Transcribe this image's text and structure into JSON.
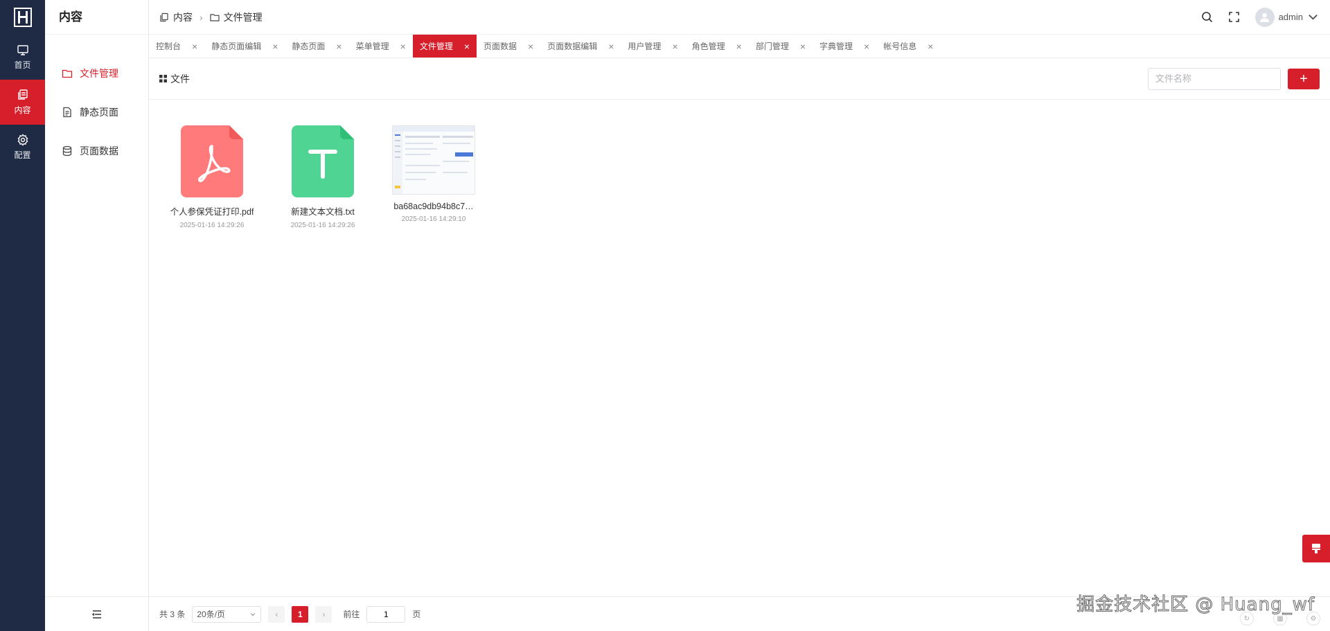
{
  "rail": {
    "items": [
      {
        "label": "首页",
        "icon": "monitor-icon"
      },
      {
        "label": "内容",
        "icon": "copy-icon"
      },
      {
        "label": "配置",
        "icon": "gear-icon"
      }
    ]
  },
  "submenu": {
    "title": "内容",
    "items": [
      {
        "label": "文件管理",
        "icon": "folder-icon"
      },
      {
        "label": "静态页面",
        "icon": "document-icon"
      },
      {
        "label": "页面数据",
        "icon": "database-icon"
      }
    ]
  },
  "breadcrumb": {
    "section": "内容",
    "page": "文件管理"
  },
  "user": {
    "name": "admin"
  },
  "tabs": [
    {
      "label": "控制台"
    },
    {
      "label": "静态页面编辑"
    },
    {
      "label": "静态页面"
    },
    {
      "label": "菜单管理"
    },
    {
      "label": "文件管理"
    },
    {
      "label": "页面数据"
    },
    {
      "label": "页面数据编辑"
    },
    {
      "label": "用户管理"
    },
    {
      "label": "角色管理"
    },
    {
      "label": "部门管理"
    },
    {
      "label": "字典管理"
    },
    {
      "label": "帐号信息"
    }
  ],
  "toolbar": {
    "label": "文件",
    "search_placeholder": "文件名称",
    "add_label": "+"
  },
  "files": [
    {
      "name": "个人参保凭证打印.pdf",
      "date": "2025-01-16 14:29:26",
      "type": "pdf"
    },
    {
      "name": "新建文本文档.txt",
      "date": "2025-01-16 14:29:26",
      "type": "txt"
    },
    {
      "name": "ba68ac9db94b8c7…",
      "date": "2025-01-16 14:29:10",
      "type": "image"
    }
  ],
  "pager": {
    "total": "共 3 条",
    "page_size": "20条/页",
    "current": "1",
    "goto_label": "前往",
    "goto_value": "1",
    "page_unit": "页"
  },
  "watermark": "掘金技术社区 @ Huang_wf",
  "colors": {
    "accent": "#d71f2c",
    "rail_bg": "#1f2a44",
    "pdf": "#ff7b7b",
    "txt": "#4fd494"
  }
}
